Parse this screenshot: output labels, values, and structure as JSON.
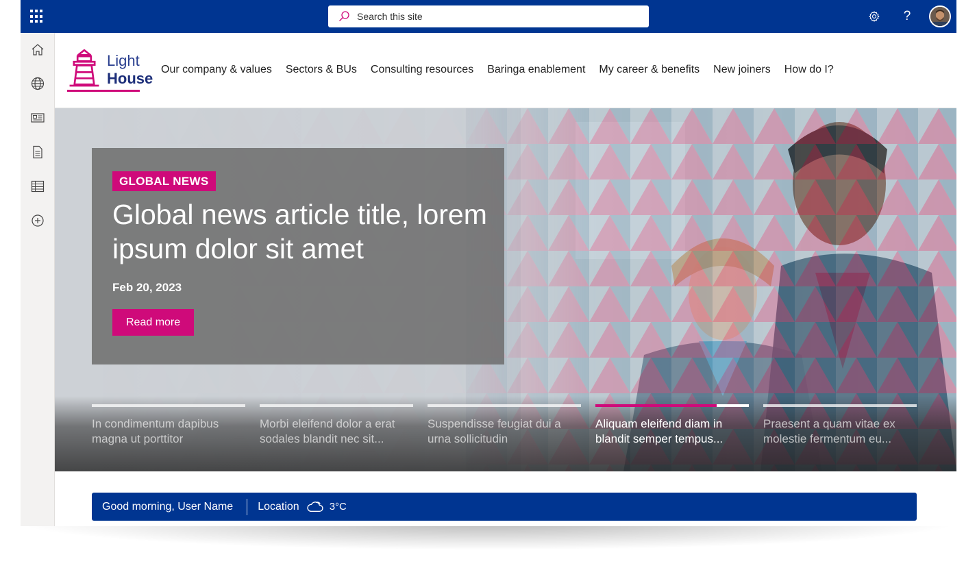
{
  "suitebar": {
    "search_placeholder": "Search this site",
    "settings_icon": "gear-icon",
    "help_label": "?",
    "avatar": "user-avatar"
  },
  "appbar": {
    "items": [
      "home-icon",
      "globe-icon",
      "news-icon",
      "document-icon",
      "list-icon",
      "add-icon"
    ]
  },
  "site": {
    "logo_top": "Light",
    "logo_bottom": "House",
    "nav": [
      "Our company & values",
      "Sectors & BUs",
      "Consulting resources",
      "Baringa enablement",
      "My career & benefits",
      "New joiners",
      "How do I?"
    ]
  },
  "hero": {
    "tag": "GLOBAL NEWS",
    "title": "Global news article title, lorem ipsum dolor sit amet",
    "date": "Feb 20, 2023",
    "cta": "Read more",
    "slides": [
      {
        "text": "In condimentum dapibus magna ut porttitor",
        "active": false,
        "progress": 0
      },
      {
        "text": "Morbi eleifend dolor a erat sodales blandit nec sit...",
        "active": false,
        "progress": 0
      },
      {
        "text": "Suspendisse feugiat dui a urna sollicitudin",
        "active": false,
        "progress": 0
      },
      {
        "text": "Aliquam eleifend diam in blandit semper tempus...",
        "active": true,
        "progress": 0.79
      },
      {
        "text": "Praesent a quam vitae ex molestie fermentum eu...",
        "active": false,
        "progress": 0
      }
    ]
  },
  "greeting": {
    "text": "Good morning, User Name",
    "location": "Location",
    "weather_icon": "cloud-icon",
    "temperature": "3°C"
  },
  "colors": {
    "brand_blue": "#003591",
    "accent_magenta": "#cf0a7a"
  }
}
